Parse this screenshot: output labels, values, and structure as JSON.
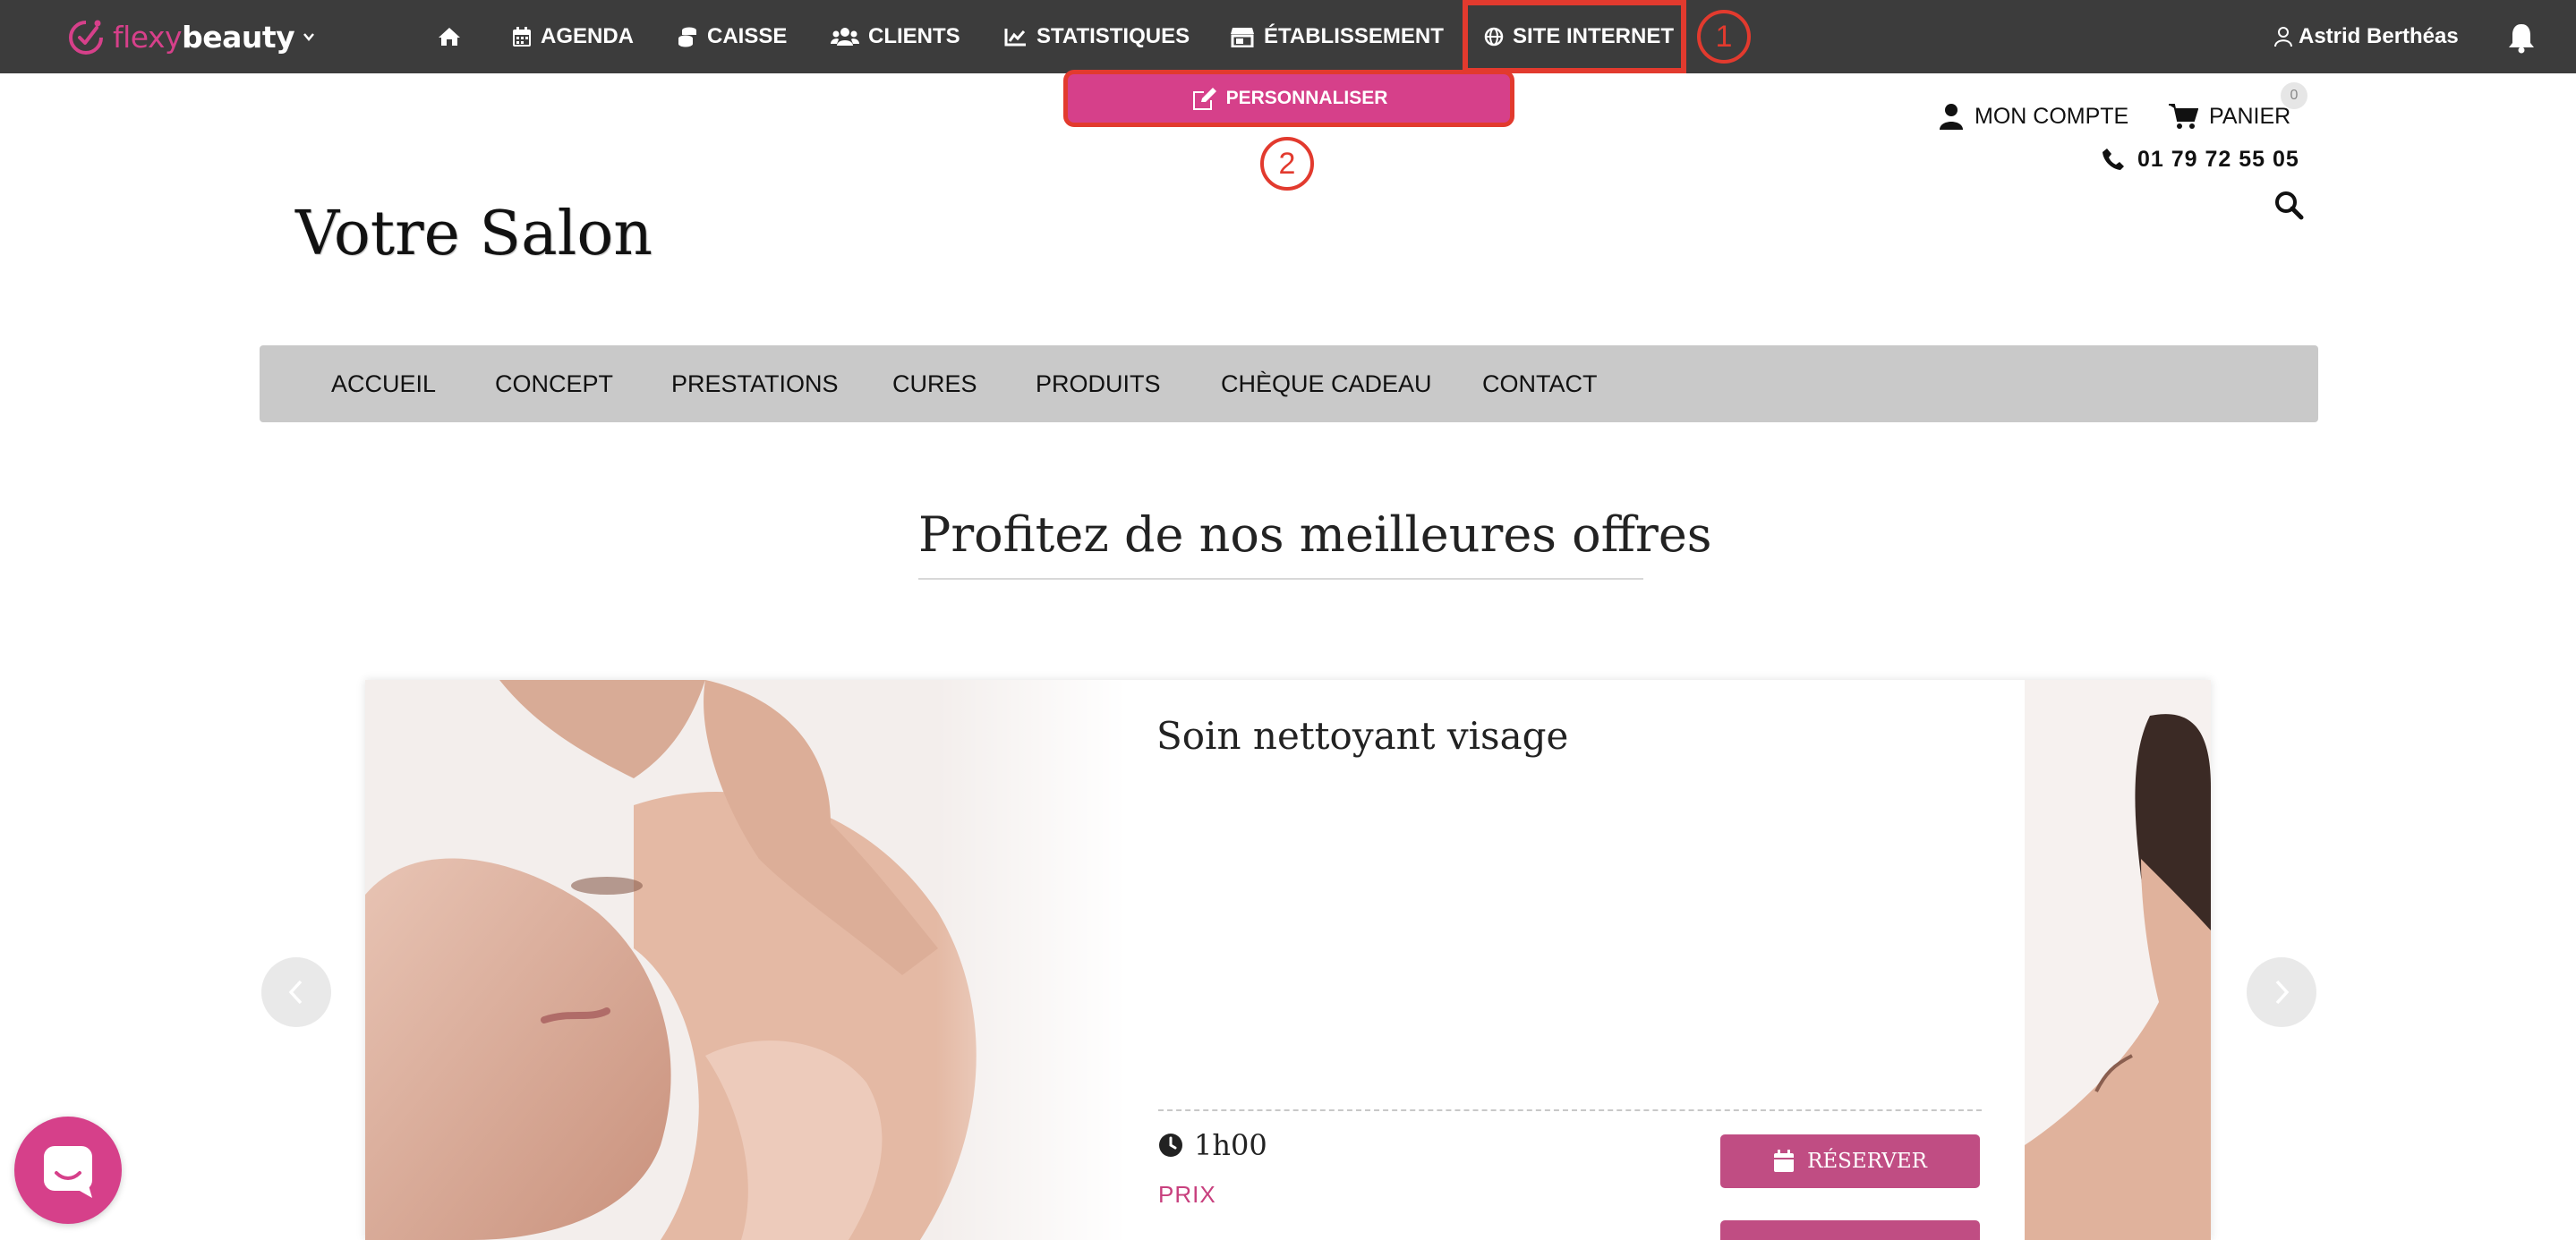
{
  "app": {
    "brand_part1": "flexy",
    "brand_part2": "beauty",
    "nav": {
      "agenda": "AGENDA",
      "caisse": "CAISSE",
      "clients": "CLIENTS",
      "statistiques": "STATISTIQUES",
      "etablissement": "ÉTABLISSEMENT",
      "site_internet": "SITE INTERNET"
    },
    "user_name": "Astrid Berthéas",
    "personnaliser_label": "PERSONNALISER"
  },
  "annotations": {
    "step1": "1",
    "step2": "2",
    "highlight_color": "#e23a2e"
  },
  "site": {
    "salon_name": "Votre Salon",
    "account_label": "MON COMPTE",
    "cart_label": "PANIER",
    "cart_count": "0",
    "phone": "01 79 72 55 05",
    "menu": [
      "ACCUEIL",
      "CONCEPT",
      "PRESTATIONS",
      "CURES",
      "PRODUITS",
      "CHÈQUE CADEAU",
      "CONTACT"
    ],
    "offers_title": "Profitez de nos meilleures offres",
    "offer": {
      "title": "Soin nettoyant visage",
      "duration": "1h00",
      "price_label": "PRIX",
      "reserve_label": "RÉSERVER"
    }
  },
  "colors": {
    "topbar": "#3c3c3c",
    "brand_pink": "#d6408a",
    "button_pink": "#c04d83",
    "site_nav_bg": "#c9c9c9"
  },
  "icons": [
    "home-icon",
    "calendar-icon",
    "coins-icon",
    "users-icon",
    "chart-icon",
    "store-icon",
    "globe-icon",
    "user-icon",
    "bell-icon",
    "edit-icon",
    "cart-icon",
    "phone-icon",
    "search-icon",
    "clock-icon",
    "chevron-left-icon",
    "chevron-right-icon",
    "chat-icon"
  ]
}
